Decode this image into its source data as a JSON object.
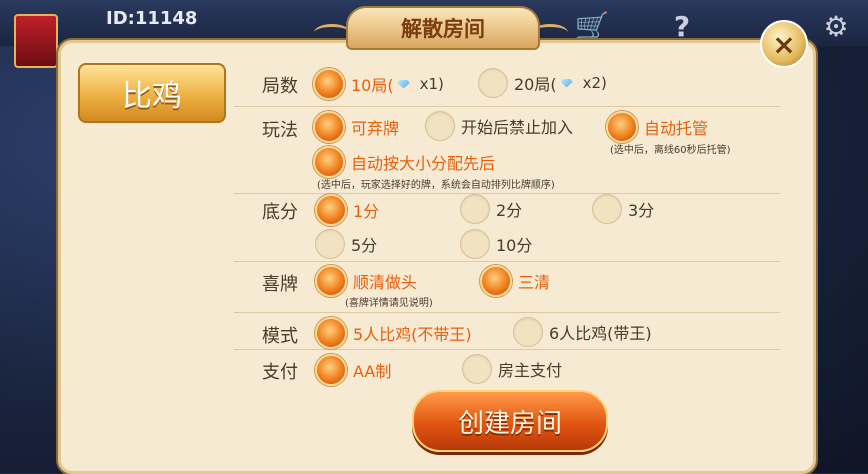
{
  "header": {
    "user_id": "ID:11148"
  },
  "dialog": {
    "title": "解散房间",
    "side_tab": "比鸡",
    "create_button": "创建房间",
    "rows": {
      "rounds": {
        "label": "局数",
        "options": [
          {
            "label": "10局(",
            "mult": "x1)",
            "selected": true
          },
          {
            "label": "20局(",
            "mult": "x2)",
            "selected": false
          }
        ]
      },
      "play": {
        "label": "玩法",
        "options": [
          {
            "label": "可弃牌",
            "selected": true
          },
          {
            "label": "开始后禁止加入",
            "selected": false
          },
          {
            "label": "自动托管",
            "selected": true
          },
          {
            "label": "自动按大小分配先后",
            "selected": true
          }
        ],
        "note_trustee": "(选中后，离线60秒后托管)",
        "note_auto": "(选中后，玩家选择好的牌，系统会自动排列比牌顺序)"
      },
      "base": {
        "label": "底分",
        "options": [
          {
            "label": "1分",
            "selected": true
          },
          {
            "label": "2分",
            "selected": false
          },
          {
            "label": "3分",
            "selected": false
          },
          {
            "label": "5分",
            "selected": false
          },
          {
            "label": "10分",
            "selected": false
          }
        ]
      },
      "happy": {
        "label": "喜牌",
        "options": [
          {
            "label": "顺清做头",
            "selected": true
          },
          {
            "label": "三清",
            "selected": true
          }
        ],
        "note": "(喜牌详情请见说明)"
      },
      "mode": {
        "label": "模式",
        "options": [
          {
            "label": "5人比鸡(不带王)",
            "selected": true
          },
          {
            "label": "6人比鸡(带王)",
            "selected": false
          }
        ]
      },
      "pay": {
        "label": "支付",
        "options": [
          {
            "label": "AA制",
            "selected": true
          },
          {
            "label": "房主支付",
            "selected": false
          }
        ]
      }
    }
  },
  "icons": {
    "close": "×",
    "help": "?",
    "cart": "🛒",
    "gear": "⚙"
  },
  "colors": {
    "panel": "#f6ead2",
    "accent": "#e66010",
    "button": "#e25610"
  }
}
